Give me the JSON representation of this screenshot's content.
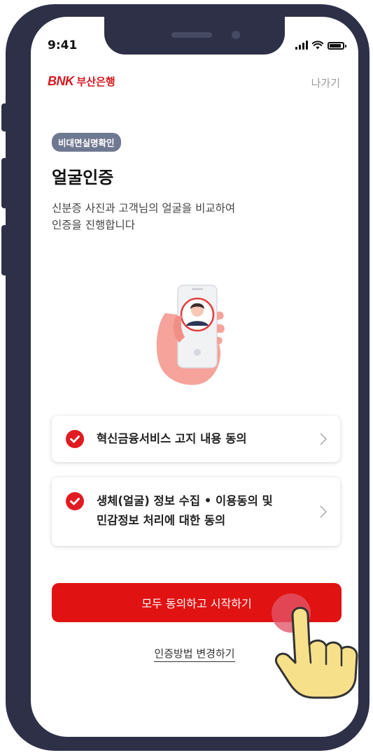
{
  "status": {
    "time": "9:41"
  },
  "header": {
    "logo_mark": "BNK",
    "logo_text": "부산은행",
    "exit": "나가기"
  },
  "badge": "비대면실명확인",
  "title": "얼굴인증",
  "description": [
    "신분증 사진과 고객님의 얼굴을 비교하여",
    "인증을 진행합니다"
  ],
  "agreements": [
    {
      "lines": [
        "혁신금융서비스 고지 내용 동의"
      ],
      "checked": true
    },
    {
      "lines": [
        "생체(얼굴) 정보 수집 • 이용동의 및",
        "민감정보 처리에 대한 동의"
      ],
      "checked": true
    }
  ],
  "primary_button": "모두 동의하고 시작하기",
  "change_link": "인증방법 변경하기",
  "colors": {
    "brand": "#d71920",
    "button": "#e11212",
    "badge": "#6f7891",
    "frame": "#2d3047"
  },
  "icons": [
    "check-circle-icon",
    "chevron-right-icon",
    "signal-icon",
    "wifi-icon",
    "battery-icon",
    "face-auth-illustration",
    "tap-hand-icon"
  ]
}
